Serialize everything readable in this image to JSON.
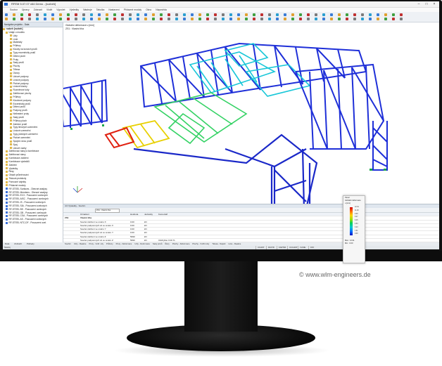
{
  "window": {
    "title": "RFEM 5.07.07 x64 Demo - [rozbeh]",
    "icon_name": "rfem-app-icon"
  },
  "menu": [
    "Soubor",
    "Úpravy",
    "Zobrazit",
    "Vložit",
    "Výpočet",
    "Výsledky",
    "Nástroje",
    "Tabulka",
    "Nastavení",
    "Přídavné moduly",
    "Okno",
    "Nápověda"
  ],
  "nav": {
    "title": "Navigátor projektu - Data",
    "root": "rozbeh [rozbeh]",
    "items": [
      "Údaje o modelu",
      "Uzly",
      "Linie",
      "Materiály",
      "Průřezy",
      "Klouby na koncích prutů",
      "Typy excentricity prutů",
      "Dělení prutů",
      "Pruty",
      "Sady prutů",
      "Plochy",
      "Tělesa",
      "Otvory",
      "Uzlové podpory",
      "Liniové podpory",
      "Plošné podpory",
      "Liniové klouby",
      "Rozměrové kóty",
      "Zatěžovací plochy",
      "Průřezy",
      "Kloubové podpory",
      "Excentricity prutů",
      "Dělení prutů",
      "Podpory prutů",
      "Nelineární pruty",
      "Sady prutů",
      "Průřezy ploch",
      "Zatížení prutů",
      "Typy liniových uzemnění",
      "Liniové uzemnění",
      "Typy plošných uzemnění",
      "Plošné uzemnění",
      "Spojení dvou prutů",
      "Spoj",
      "Uzlové vazby",
      "Zatěžovací stavy a kombinace",
      "Zatěžovací stavy",
      "Kombinace zatížení",
      "Kombinace výsledků",
      "Zatížení",
      "Výsledky",
      "Řezy",
      "Obsah průměrování",
      "Tisková protokoly",
      "Pomocné objekty",
      "Přídavné moduly",
      "RF-STEEL Surfaces - Obecné analýzy",
      "RF-STEEL Members - Obecné analýzy",
      "RF-STEEL EC3 - Posouzení ocelových",
      "RF-STEEL AISC - Posouzení ocelových",
      "RF-STEEL IS - Posouzení ocelových",
      "RF-STEEL SIA - Posouzení ocelových",
      "RF-STEEL BS - Posouzení ocelových",
      "RF-STEEL GB - Posouzení ocelových",
      "RF-STEEL CSA - Posouzení ocelových",
      "RF-STEEL AS - Posouzení ocelových",
      "RF-STEEL NTC-DF - Posouzení ocel."
    ],
    "tabs": [
      "Data",
      "Zobrazit",
      "Pohledy"
    ]
  },
  "viewport": {
    "line1": "Globální deformace u [mm]",
    "line2": "ZS1 : Vlastní tíha"
  },
  "table": {
    "title": "4.0 Výsledky - Souhrn",
    "toolbar_label": "ZS1 - Vlastní tíha",
    "headers": [
      "",
      "Označení",
      "Hodnota",
      "Jednotky",
      "Komentář"
    ],
    "rows": [
      [
        "ZS1",
        "Vlastní tíha",
        "",
        "",
        ""
      ],
      [
        "",
        "Součet zatížení ve směru X",
        "0.00",
        "kN",
        ""
      ],
      [
        "",
        "Součet podporových sil ve směru X",
        "0.00",
        "kN",
        ""
      ],
      [
        "",
        "Součet zatížení ve směru Y",
        "0.00",
        "kN",
        ""
      ],
      [
        "",
        "Součet podporových sil ve směru Y",
        "0.00",
        "kN",
        ""
      ],
      [
        "",
        "Součet zatížení ve směru Z",
        "5990",
        "kN",
        ""
      ],
      [
        "",
        "Součet podporových sil ve směru Z",
        "5990",
        "kN",
        "Odchylka: 0.00 %"
      ]
    ],
    "tabs": [
      "Souhrn",
      "Uzly - Reakce",
      "Pruty - Vnitř. síly",
      "Průřezy",
      "Pruty - Deformace",
      "Uzly - Deformace",
      "Sady prutů",
      "Řezy",
      "Plochy - Deformace",
      "Plochy - Vnitřní síly",
      "Tělesa - Napětí",
      "Linie - Reakce"
    ]
  },
  "status": {
    "left": "Nástroj",
    "buttons": [
      "UCHOP",
      "RASTR",
      "KARTÉZ",
      "OUCHOP",
      "VLINIE",
      "DXF"
    ]
  },
  "legend": {
    "title": "Panel",
    "subtitle": "Globální deformace",
    "unit": "u [mm]",
    "values": [
      "12.91",
      "11.29",
      "9.68",
      "8.07",
      "6.45",
      "4.84",
      "3.23",
      "1.61",
      "0.00"
    ],
    "max_label": "Max : 12.91",
    "min_label": "Min : 0.00"
  },
  "watermark": "© www.wlm-engineers.de"
}
